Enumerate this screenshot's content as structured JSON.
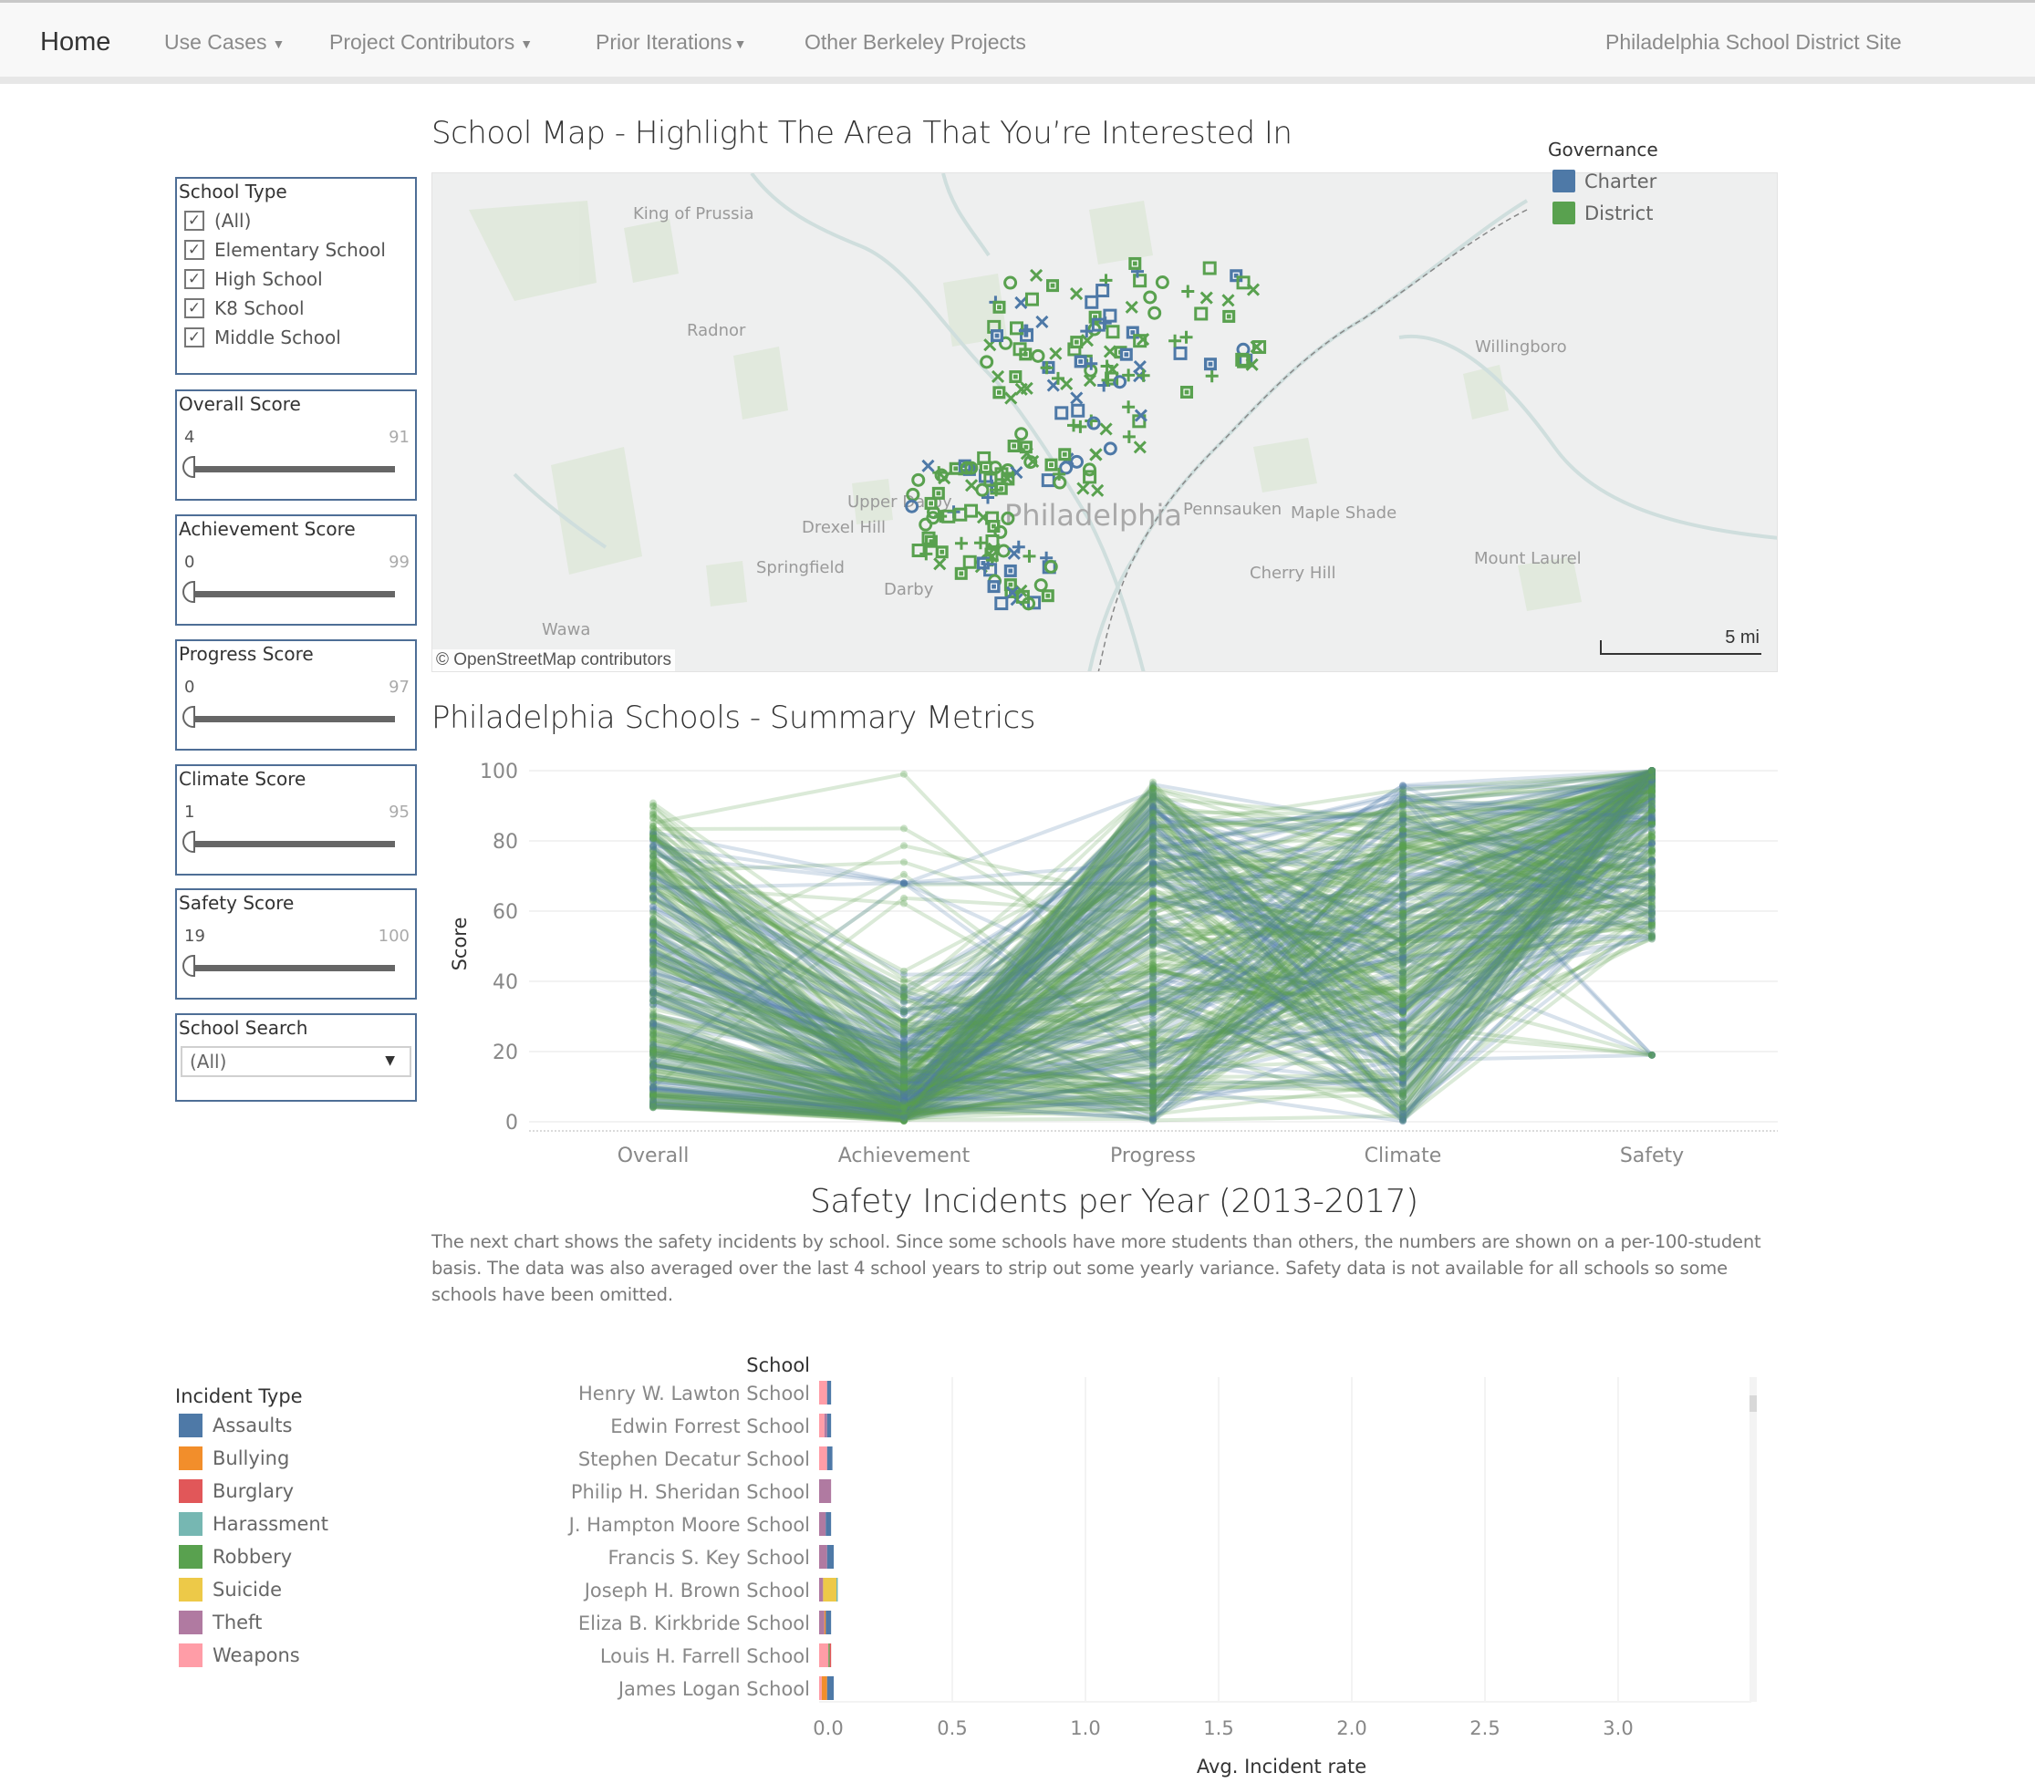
{
  "nav": {
    "home": "Home",
    "items": [
      {
        "label": "Use Cases",
        "has_caret": true
      },
      {
        "label": "Project Contributors",
        "has_caret": true
      },
      {
        "label": "Prior Iterations",
        "has_caret": true
      },
      {
        "label": "Other Berkeley Projects",
        "has_caret": false
      }
    ],
    "right_link": "Philadelphia School District Site",
    "caret_icon": "▼"
  },
  "filters": {
    "school_type": {
      "title": "School Type",
      "options": [
        {
          "label": "(All)",
          "checked": true
        },
        {
          "label": "Elementary School",
          "checked": true
        },
        {
          "label": "High School",
          "checked": true
        },
        {
          "label": "K8 School",
          "checked": true
        },
        {
          "label": "Middle School",
          "checked": true
        }
      ],
      "check_glyph": "✓"
    },
    "sliders": [
      {
        "title": "Overall Score",
        "min": "4",
        "max": "91"
      },
      {
        "title": "Achievement Score",
        "min": "0",
        "max": "99"
      },
      {
        "title": "Progress Score",
        "min": "0",
        "max": "97"
      },
      {
        "title": "Climate Score",
        "min": "1",
        "max": "95"
      },
      {
        "title": "Safety Score",
        "min": "19",
        "max": "100"
      }
    ],
    "school_search": {
      "title": "School Search",
      "value": "(All)",
      "arrow": "▼"
    }
  },
  "map": {
    "title": "School Map - Highlight The Area That You’re Interested In",
    "places": [
      "King of Prussia",
      "Radnor",
      "Upper Darby",
      "Drexel Hill",
      "Springfield",
      "Darby",
      "Wawa",
      "Philadelphia",
      "Pennsauken",
      "Maple Shade",
      "Cherry Hill",
      "Willingboro",
      "Mount Laurel"
    ],
    "attribution": "© OpenStreetMap contributors",
    "scale_label": "5 mi",
    "legend": {
      "title": "Governance",
      "items": [
        {
          "label": "Charter",
          "color": "#4e79a7"
        },
        {
          "label": "District",
          "color": "#59a14f"
        }
      ]
    },
    "marker_shapes": [
      "plus",
      "circle",
      "square",
      "cross",
      "filled-square"
    ]
  },
  "summary": {
    "title": "Philadelphia Schools - Summary Metrics"
  },
  "safety": {
    "title": "Safety Incidents per Year (2013-2017)",
    "description": "The next chart shows the safety incidents by school. Since some schools have more students than others, the numbers are shown on a per-100-student basis. The data was also averaged over the last 4 school years to strip out some yearly variance. Safety data is not available for all schools so some schools have been omitted.",
    "legend": {
      "title": "Incident Type",
      "items": [
        {
          "label": "Assaults",
          "color": "#4e79a7"
        },
        {
          "label": "Bullying",
          "color": "#f28e2b"
        },
        {
          "label": "Burglary",
          "color": "#e15759"
        },
        {
          "label": "Harassment",
          "color": "#76b7b2"
        },
        {
          "label": "Robbery",
          "color": "#59a14f"
        },
        {
          "label": "Suicide",
          "color": "#edc948"
        },
        {
          "label": "Theft",
          "color": "#b07aa1"
        },
        {
          "label": "Weapons",
          "color": "#ff9da7"
        }
      ]
    }
  },
  "chart_data": [
    {
      "type": "line",
      "subtype": "parallel-coordinates",
      "title": "Philadelphia Schools - Summary Metrics",
      "xlabel": "",
      "ylabel": "Score",
      "categories": [
        "Overall",
        "Achievement",
        "Progress",
        "Climate",
        "Safety"
      ],
      "yticks": [
        "0",
        "20",
        "40",
        "60",
        "80",
        "100"
      ],
      "ylim": [
        0,
        100
      ],
      "grid": true,
      "series_groups": [
        {
          "name": "Charter",
          "color": "#4e79a7",
          "approx_ranges": {
            "Overall": [
              4,
              84
            ],
            "Achievement": [
              0,
              68
            ],
            "Progress": [
              0,
              98
            ],
            "Climate": [
              2,
              96
            ],
            "Safety": null
          }
        },
        {
          "name": "District",
          "color": "#59a14f",
          "approx_ranges": {
            "Overall": [
              4,
              91
            ],
            "Achievement": [
              0,
              99
            ],
            "Progress": [
              0,
              97
            ],
            "Climate": [
              1,
              95
            ],
            "Safety": [
              19,
              100
            ]
          }
        }
      ],
      "notes": "Hundreds of semi-transparent polylines, one per school; values shown are the visible extents per axis."
    },
    {
      "type": "bar",
      "subtype": "stacked-horizontal",
      "title": "Safety Incidents per Year (2013-2017)",
      "xlabel": "Avg. Incident rate",
      "ylabel": "School",
      "xlim": [
        0,
        3.45
      ],
      "xticks": [
        "0.0",
        "0.5",
        "1.0",
        "1.5",
        "2.0",
        "2.5",
        "3.0"
      ],
      "grid": true,
      "categories": [
        "Henry W. Lawton School",
        "Edwin Forrest School",
        "Stephen Decatur School",
        "Philip H. Sheridan School",
        "J. Hampton Moore School",
        "Francis S. Key School",
        "Joseph H. Brown School",
        "Eliza B. Kirkbride School",
        "Louis H. Farrell School",
        "James Logan School"
      ],
      "series": [
        {
          "name": "Weapons",
          "values": [
            0.03,
            0.02,
            0.03,
            0.0,
            0.0,
            0.0,
            0.0,
            0.0,
            0.035,
            0.01
          ]
        },
        {
          "name": "Theft",
          "values": [
            0.0,
            0.01,
            0.0,
            0.045,
            0.025,
            0.03,
            0.015,
            0.02,
            0.0,
            0.0
          ]
        },
        {
          "name": "Bullying",
          "values": [
            0.0,
            0.0,
            0.0,
            0.0,
            0.0,
            0.0,
            0.0,
            0.005,
            0.0,
            0.02
          ]
        },
        {
          "name": "Robbery",
          "values": [
            0.0,
            0.0,
            0.0,
            0.0,
            0.0,
            0.0,
            0.0,
            0.0,
            0.005,
            0.0
          ]
        },
        {
          "name": "Burglary",
          "values": [
            0.0,
            0.0,
            0.0,
            0.0,
            0.0,
            0.0,
            0.0,
            0.0,
            0.005,
            0.0
          ]
        },
        {
          "name": "Suicide",
          "values": [
            0.0,
            0.0,
            0.0,
            0.0,
            0.0,
            0.0,
            0.05,
            0.0,
            0.0,
            0.0
          ]
        },
        {
          "name": "Harassment",
          "values": [
            0.0,
            0.0,
            0.0,
            0.0,
            0.0,
            0.0,
            0.005,
            0.0,
            0.0,
            0.0
          ]
        },
        {
          "name": "Assaults",
          "values": [
            0.015,
            0.015,
            0.02,
            0.0,
            0.02,
            0.025,
            0.0,
            0.02,
            0.0,
            0.025
          ]
        }
      ]
    }
  ]
}
